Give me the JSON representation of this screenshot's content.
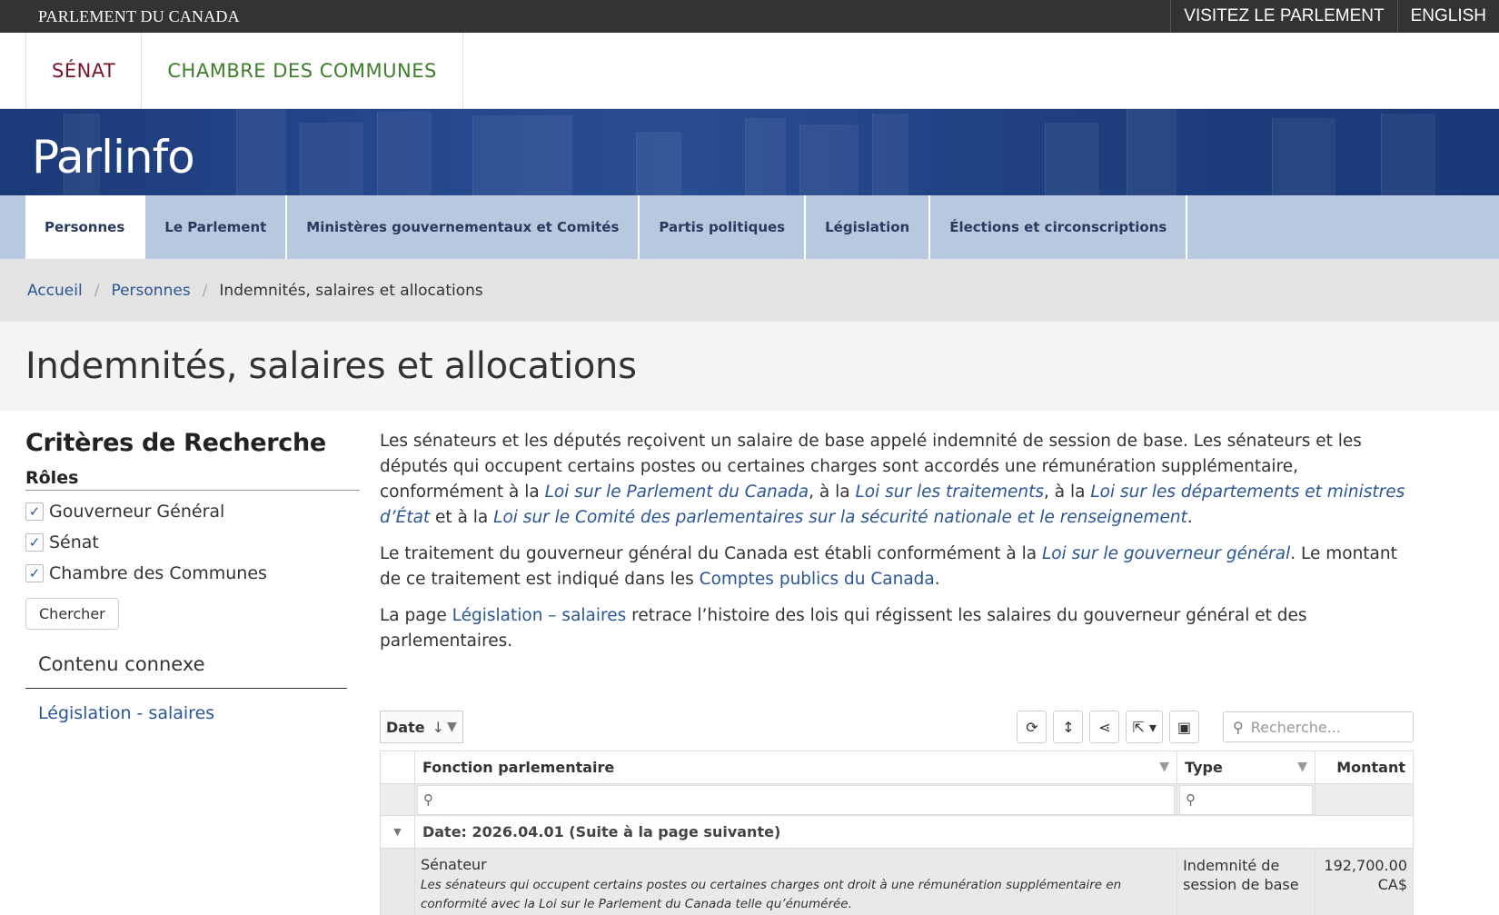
{
  "topbar": {
    "brand": "PARLEMENT DU CANADA",
    "visit": "VISITEZ LE PARLEMENT",
    "lang": "ENGLISH"
  },
  "chambers": {
    "senate": "SÉNAT",
    "commons": "CHAMBRE DES COMMUNES"
  },
  "banner": {
    "title": "Parlinfo"
  },
  "nav": {
    "tabs": [
      {
        "label": "Personnes",
        "active": true
      },
      {
        "label": "Le Parlement"
      },
      {
        "label": "Ministères gouvernementaux et Comités"
      },
      {
        "label": "Partis politiques"
      },
      {
        "label": "Législation"
      },
      {
        "label": "Élections et circonscriptions"
      }
    ]
  },
  "breadcrumb": {
    "home": "Accueil",
    "people": "Personnes",
    "current": "Indemnités, salaires et allocations"
  },
  "page": {
    "title": "Indemnités, salaires et allocations"
  },
  "sidebar": {
    "heading": "Critères de Recherche",
    "roles_heading": "Rôles",
    "roles": [
      {
        "label": "Gouverneur Général",
        "checked": true
      },
      {
        "label": "Sénat",
        "checked": true
      },
      {
        "label": "Chambre des Communes",
        "checked": true
      }
    ],
    "search_button": "Chercher",
    "related_heading": "Contenu connexe",
    "related_link": "Législation - salaires"
  },
  "intro": {
    "p1_a": "Les sénateurs et les députés reçoivent un salaire de base appelé indemnité de session de base. Les sénateurs et les députés qui occupent certains postes ou certaines charges sont accordés une rémunération supplémentaire, conformément à la ",
    "p1_link1": "Loi sur le Parlement du Canada",
    "p1_b": ", à la ",
    "p1_link2": "Loi sur les traitements",
    "p1_c": ", à la ",
    "p1_link3": "Loi sur les départements et ministres d’État",
    "p1_d": " et à la ",
    "p1_link4": "Loi sur le Comité des parlementaires sur la sécurité nationale et le renseignement",
    "p1_e": ".",
    "p2_a": "Le traitement du gouverneur général du Canada est établi conformément à la ",
    "p2_link1": "Loi sur le gouverneur général",
    "p2_b": ". Le montant de ce traitement est indiqué dans les ",
    "p2_link2": "Comptes publics du Canada",
    "p2_c": ".",
    "p3_a": "La page ",
    "p3_link": "Législation – salaires",
    "p3_b": " retrace l’histoire des lois qui régissent les salaires du gouverneur général et des parlementaires."
  },
  "grid": {
    "group_chip": "Date",
    "search_placeholder": "Recherche...",
    "columns": {
      "function": "Fonction parlementaire",
      "type": "Type",
      "amount": "Montant"
    },
    "group_label": "Date: 2026.04.01 (Suite à la page suivante)",
    "rows": [
      {
        "title": "Sénateur",
        "description": "Les sénateurs qui occupent certains postes ou certaines charges ont droit à une rémunération supplémentaire en conformité avec la Loi sur le Parlement du Canada telle qu’énumérée.",
        "type": "Indemnité de session de base",
        "amount": "192,700.00 CA$"
      }
    ]
  }
}
